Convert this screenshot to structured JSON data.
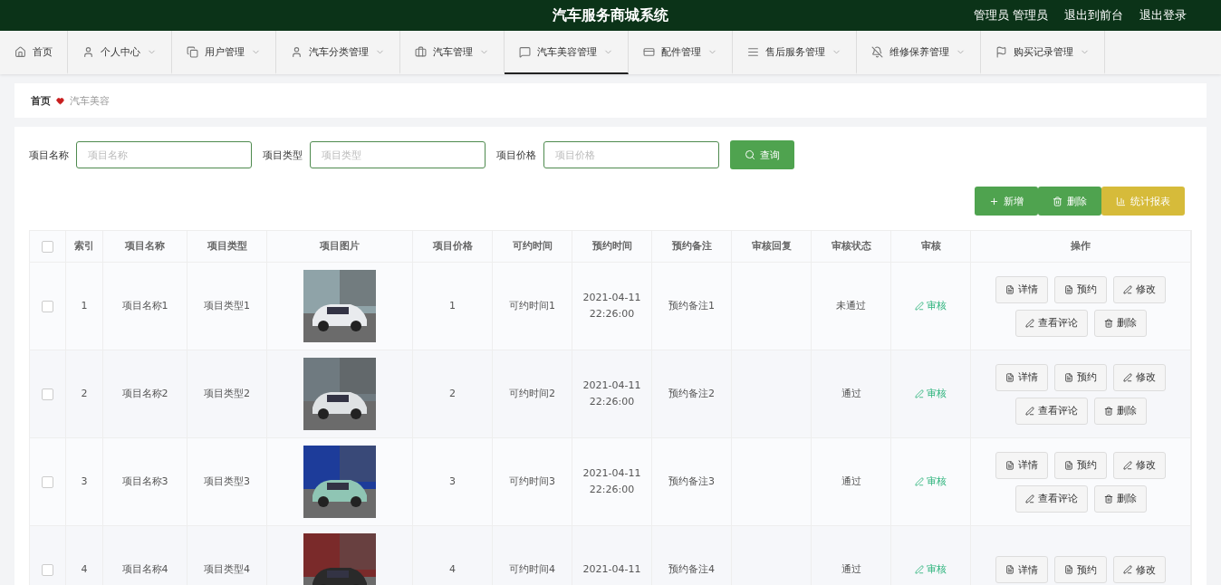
{
  "header": {
    "title": "汽车服务商城系统",
    "links": [
      "管理员 管理员",
      "退出到前台",
      "退出登录"
    ]
  },
  "nav": [
    {
      "label": "首页",
      "has_menu": false,
      "selected": false
    },
    {
      "label": "个人中心",
      "has_menu": true,
      "selected": false
    },
    {
      "label": "用户管理",
      "has_menu": true,
      "selected": false
    },
    {
      "label": "汽车分类管理",
      "has_menu": true,
      "selected": false
    },
    {
      "label": "汽车管理",
      "has_menu": true,
      "selected": false
    },
    {
      "label": "汽车美容管理",
      "has_menu": true,
      "selected": true
    },
    {
      "label": "配件管理",
      "has_menu": true,
      "selected": false
    },
    {
      "label": "售后服务管理",
      "has_menu": true,
      "selected": false
    },
    {
      "label": "维修保养管理",
      "has_menu": true,
      "selected": false
    },
    {
      "label": "购买记录管理",
      "has_menu": true,
      "selected": false
    }
  ],
  "breadcrumb": [
    "首页",
    "汽车美容"
  ],
  "search": {
    "fields": [
      {
        "label": "项目名称",
        "placeholder": "项目名称"
      },
      {
        "label": "项目类型",
        "placeholder": "项目类型"
      },
      {
        "label": "项目价格",
        "placeholder": "项目价格"
      }
    ],
    "button": "查询"
  },
  "toolbar": [
    {
      "kind": "add",
      "label": "新增"
    },
    {
      "kind": "delete",
      "label": "删除"
    },
    {
      "kind": "report",
      "label": "统计报表"
    }
  ],
  "table": {
    "select_all": {
      "checked": false
    },
    "columns": [
      "索引",
      "项目名称",
      "项目类型",
      "项目图片",
      "项目价格",
      "可约时间",
      "预约时间",
      "预约备注",
      "审核回复",
      "审核状态",
      "审核",
      "操作"
    ],
    "rows": [
      {
        "checked": false,
        "index": "1",
        "name": "项目名称1",
        "type": "项目类型1",
        "image": {
          "kind": "picture"
        },
        "price": "1",
        "available_time": "可约时间1",
        "booking_time": [
          "2021-04-11",
          "22:26:00"
        ],
        "note": "预约备注1",
        "reply": "",
        "status": "未通过",
        "review": "审核",
        "actions": [
          {
            "kind": "detail",
            "label": "详情"
          },
          {
            "kind": "book",
            "label": "预约"
          },
          {
            "kind": "edit",
            "label": "修改"
          },
          {
            "kind": "comment",
            "label": "查看评论"
          },
          {
            "kind": "delete",
            "label": "删除"
          }
        ]
      },
      {
        "checked": false,
        "index": "2",
        "name": "项目名称2",
        "type": "项目类型2",
        "image": {
          "kind": "picture"
        },
        "price": "2",
        "available_time": "可约时间2",
        "booking_time": [
          "2021-04-11",
          "22:26:00"
        ],
        "note": "预约备注2",
        "reply": "",
        "status": "通过",
        "review": "审核",
        "actions": [
          {
            "kind": "detail",
            "label": "详情"
          },
          {
            "kind": "book",
            "label": "预约"
          },
          {
            "kind": "edit",
            "label": "修改"
          },
          {
            "kind": "comment",
            "label": "查看评论"
          },
          {
            "kind": "delete",
            "label": "删除"
          }
        ]
      },
      {
        "checked": false,
        "index": "3",
        "name": "项目名称3",
        "type": "项目类型3",
        "image": {
          "kind": "picture"
        },
        "price": "3",
        "available_time": "可约时间3",
        "booking_time": [
          "2021-04-11",
          "22:26:00"
        ],
        "note": "预约备注3",
        "reply": "",
        "status": "通过",
        "review": "审核",
        "actions": [
          {
            "kind": "detail",
            "label": "详情"
          },
          {
            "kind": "book",
            "label": "预约"
          },
          {
            "kind": "edit",
            "label": "修改"
          },
          {
            "kind": "comment",
            "label": "查看评论"
          },
          {
            "kind": "delete",
            "label": "删除"
          }
        ]
      },
      {
        "checked": false,
        "index": "4",
        "name": "项目名称4",
        "type": "项目类型4",
        "image": {
          "kind": "picture"
        },
        "price": "4",
        "available_time": "可约时间4",
        "booking_time": [
          "2021-04-11"
        ],
        "note": "预约备注4",
        "reply": "",
        "status": "通过",
        "review": "审核",
        "actions": [
          {
            "kind": "detail",
            "label": "详情"
          },
          {
            "kind": "book",
            "label": "预约"
          },
          {
            "kind": "edit",
            "label": "修改"
          }
        ]
      }
    ]
  }
}
